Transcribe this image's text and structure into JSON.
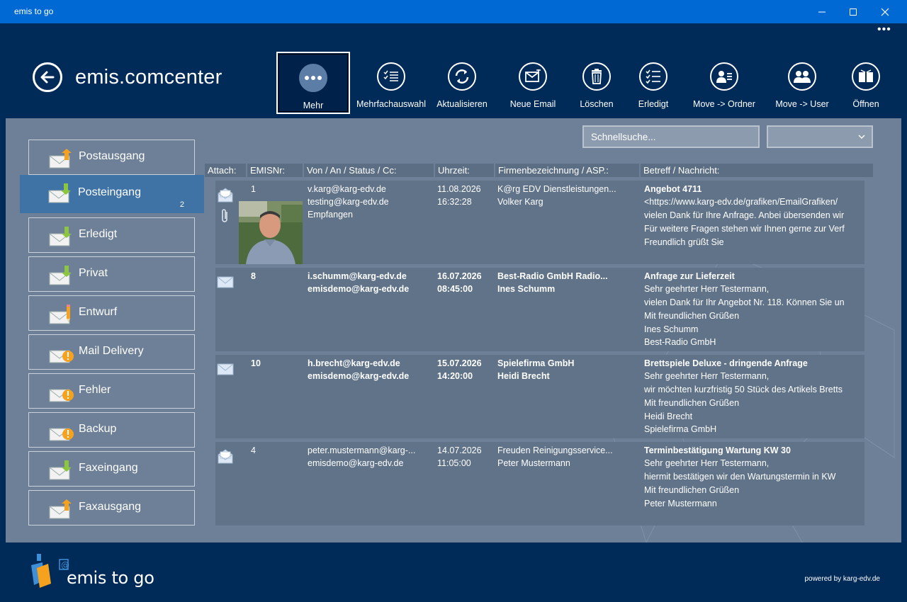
{
  "window": {
    "title": "emis to go",
    "minimize": "minimize",
    "maximize": "maximize",
    "close": "close"
  },
  "header": {
    "app_title": "emis.comcenter",
    "more_dots": "•••"
  },
  "toolbar": [
    {
      "label": "Mehr",
      "icon": "more-icon"
    },
    {
      "label": "Mehrfachauswahl",
      "icon": "multiselect-icon"
    },
    {
      "label": "Aktualisieren",
      "icon": "refresh-icon"
    },
    {
      "label": "Neue Email",
      "icon": "new-email-icon"
    },
    {
      "label": "Löschen",
      "icon": "trash-icon"
    },
    {
      "label": "Erledigt",
      "icon": "checklist-icon"
    },
    {
      "label": "Move -> Ordner",
      "icon": "move-folder-icon"
    },
    {
      "label": "Move -> User",
      "icon": "move-user-icon"
    },
    {
      "label": "Öffnen",
      "icon": "open-icon"
    }
  ],
  "search": {
    "placeholder": "Schnellsuche..."
  },
  "folders": [
    {
      "name": "Postausgang",
      "icon": "outbox-icon",
      "count": ""
    },
    {
      "name": "Posteingang",
      "icon": "inbox-icon",
      "count": "2"
    },
    {
      "name": "Erledigt",
      "icon": "inbox-icon",
      "count": ""
    },
    {
      "name": "Privat",
      "icon": "inbox-icon",
      "count": ""
    },
    {
      "name": "Entwurf",
      "icon": "draft-icon",
      "count": ""
    },
    {
      "name": "Mail Delivery",
      "icon": "warning-mail-icon",
      "count": ""
    },
    {
      "name": "Fehler",
      "icon": "warning-mail-icon",
      "count": ""
    },
    {
      "name": "Backup",
      "icon": "warning-mail-icon",
      "count": ""
    },
    {
      "name": "Faxeingang",
      "icon": "inbox-icon",
      "count": ""
    },
    {
      "name": "Faxausgang",
      "icon": "outbox-icon",
      "count": ""
    }
  ],
  "columns": {
    "attach": "Attach:",
    "emisnr": "EMISNr:",
    "from": "Von / An / Status / Cc:",
    "time": "Uhrzeit:",
    "company": "Firmenbezeichnung / ASP.:",
    "subject": "Betreff / Nachricht:"
  },
  "emails": [
    {
      "nr": "1",
      "from": "v.karg@karg-edv.de",
      "to": "testing@karg-edv.de",
      "status": "Empfangen",
      "date": "11.08.2026",
      "time": "16:32:28",
      "company": "K@rg EDV Dienstleistungen...",
      "contact": "Volker Karg",
      "subject": "Angebot 4711",
      "lines": [
        "<https://www.karg-edv.de/grafiken/EmailGrafiken/",
        "vielen Dank für Ihre Anfrage. Anbei übersenden wir",
        "Für weitere Fragen stehen wir Ihnen gerne zur Verf",
        "Freundlich grüßt Sie",
        ""
      ],
      "unread": false,
      "attachment": true,
      "photo": true
    },
    {
      "nr": "8",
      "from": "i.schumm@karg-edv.de",
      "to": "emisdemo@karg-edv.de",
      "status": "",
      "date": "16.07.2026",
      "time": "08:45:00",
      "company": "Best-Radio GmbH Radio...",
      "contact": "Ines Schumm",
      "subject": "Anfrage zur Lieferzeit",
      "lines": [
        "Sehr geehrter Herr Testermann,",
        "vielen Dank für Ihr Angebot Nr. 118. Können Sie un",
        "Mit freundlichen Grüßen",
        "Ines Schumm",
        "Best-Radio GmbH"
      ],
      "unread": true,
      "attachment": false,
      "photo": false
    },
    {
      "nr": "10",
      "from": "h.brecht@karg-edv.de",
      "to": "emisdemo@karg-edv.de",
      "status": "",
      "date": "15.07.2026",
      "time": "14:20:00",
      "company": "Spielefirma GmbH",
      "contact": "Heidi Brecht",
      "subject": "Brettspiele Deluxe - dringende Anfrage",
      "lines": [
        "Sehr geehrter Herr Testermann,",
        "wir möchten kurzfristig 50 Stück des Artikels Bretts",
        "Mit freundlichen Grüßen",
        "Heidi Brecht",
        "Spielefirma GmbH"
      ],
      "unread": true,
      "attachment": false,
      "photo": false
    },
    {
      "nr": "4",
      "from": "peter.mustermann@karg-...",
      "to": "emisdemo@karg-edv.de",
      "status": "",
      "date": "14.07.2026",
      "time": "11:05:00",
      "company": "Freuden Reinigungsservice...",
      "contact": "Peter Mustermann",
      "subject": "Terminbestätigung Wartung KW 30",
      "lines": [
        "Sehr geehrter Herr Testermann,",
        "hiermit bestätigen wir den Wartungstermin in KW",
        "Mit freundlichen Grüßen",
        "Peter Mustermann",
        ""
      ],
      "unread": false,
      "attachment": false,
      "photo": false
    }
  ],
  "footer": {
    "brand": "emis to go",
    "powered": "powered by karg-edv.de"
  },
  "colors": {
    "titlebar": "#0069d4",
    "header": "#002a57",
    "content": "#6d8097",
    "selected_folder": "#3f73a6"
  }
}
